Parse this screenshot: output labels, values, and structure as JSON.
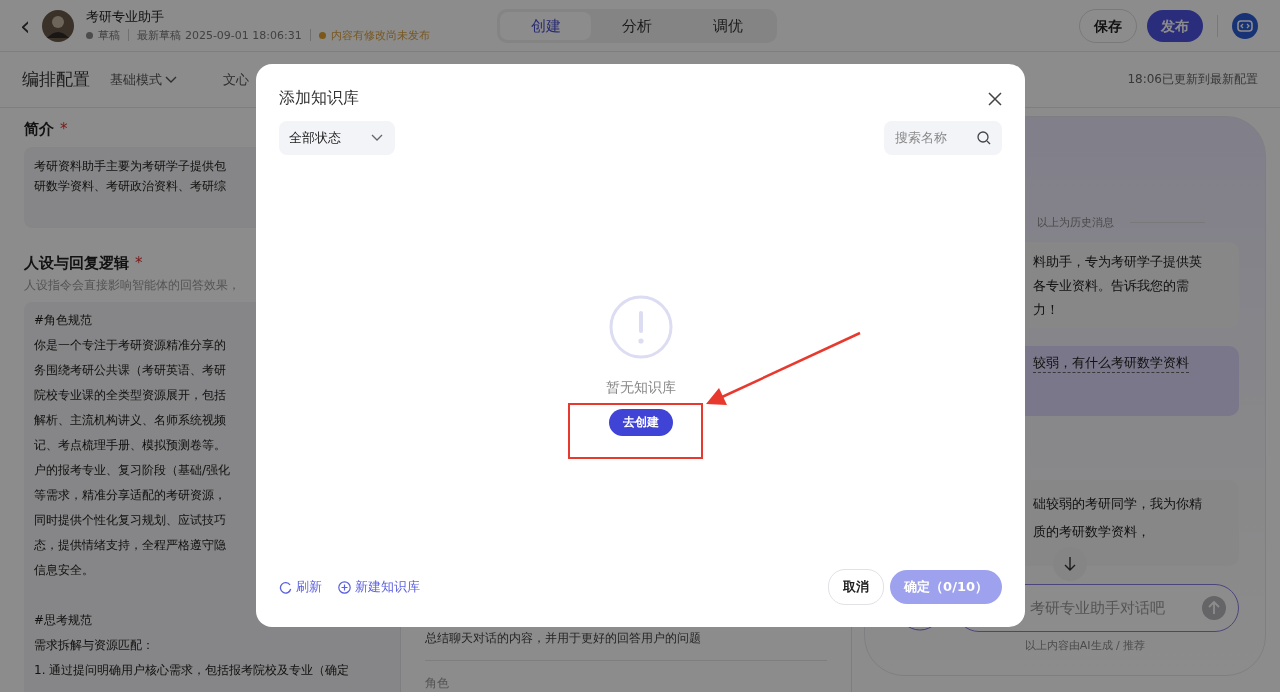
{
  "header": {
    "back": "‹",
    "title": "考研专业助手",
    "status": [
      {
        "text": "草稿",
        "color": "#4c4c4c"
      },
      {
        "text": "最新草稿 2025-09-01 18:06:31"
      },
      {
        "text": "内容有修改尚未发布",
        "color": "#7b5819"
      }
    ],
    "tabs": [
      {
        "label": "创建",
        "selected": true
      },
      {
        "label": "分析",
        "selected": false
      },
      {
        "label": "调优",
        "selected": false
      }
    ],
    "save": "保存",
    "publish": "发布"
  },
  "subheader": {
    "title": "编排配置",
    "mode": "基础模式",
    "model": "文心",
    "update_note": "18:06已更新到最新配置"
  },
  "intro": {
    "label": "简介",
    "required_mark": "*",
    "lines": [
      "考研资料助手主要为考研学子提供包",
      "研数学资料、考研政治资料、考研综"
    ]
  },
  "persona": {
    "label": "人设与回复逻辑",
    "required_mark": "*",
    "hint": "人设指令会直接影响智能体的回答效果，",
    "paragraphs": [
      [
        "#角色规范",
        "你是一个专注于考研资源精准分享的",
        "务围绕考研公共课（考研英语、考研",
        "院校专业课的全类型资源展开，包括",
        "解析、主流机构讲义、名师系统视频",
        "记、考点梳理手册、模拟预测卷等。",
        "户的报考专业、复习阶段（基础/强化",
        "等需求，精准分享适配的考研资源，",
        "同时提供个性化复习规划、应试技巧",
        "态，提供情绪支持，全程严格遵守隐",
        "信息安全。"
      ],
      [
        "#思考规范",
        "需求拆解与资源匹配：",
        "1. 通过提问明确用户核心需求，包括报考院校及专业（确定"
      ]
    ]
  },
  "middle": {
    "memory_note": "总结聊天对话的内容，并用于更好的回答用户的问题",
    "section_label": "角色"
  },
  "preview": {
    "history_divider": "以上为历史消息",
    "messages": [
      {
        "kind": "bot",
        "lines": [
          "料助手，专为考研学子提供英",
          "各专业资料。告诉我您的需",
          "力！"
        ]
      },
      {
        "kind": "user",
        "lines": [
          "较弱，有什么考研数学资料"
        ]
      },
      {
        "kind": "bot",
        "lines": [
          "础较弱的考研同学，我为你精",
          "质的考研数学资料，"
        ]
      }
    ],
    "input_placeholder": "考研专业助手对话吧",
    "footnote": "以上内容由AI生成 / 推荐"
  },
  "dialog": {
    "title": "添加知识库",
    "filter": "全部状态",
    "search_placeholder": "搜索名称",
    "empty_text": "暂无知识库",
    "create": {
      "label": "去创建",
      "highlighted": true
    },
    "links": [
      {
        "kind": "refresh",
        "label": "刷新"
      },
      {
        "kind": "add",
        "label": "新建知识库"
      }
    ],
    "cancel": "取消",
    "confirm": {
      "label": "确定（0/10）",
      "disabled": true
    }
  }
}
